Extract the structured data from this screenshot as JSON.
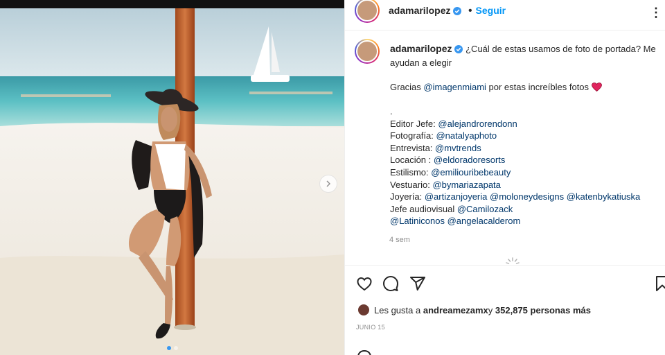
{
  "post": {
    "username": "adamarilopez",
    "follow_label": "Seguir",
    "more_label": "⋮"
  },
  "caption": {
    "username": "adamarilopez",
    "line1": "¿Cuál de estas usamos de foto de portada? Me",
    "line2": "ayudan a elegir",
    "thanks_prefix": "Gracias ",
    "thanks_mention": "@imagenmiami",
    "thanks_suffix": " por estas increíbles fotos ",
    "dot": ".",
    "credits": [
      {
        "label": "Editor Jefe: ",
        "mentions": [
          "@alejandrorendonn"
        ]
      },
      {
        "label": "Fotografía: ",
        "mentions": [
          "@natalyaphoto"
        ]
      },
      {
        "label": "Entrevista: ",
        "mentions": [
          "@mvtrends"
        ]
      },
      {
        "label": "Locación : ",
        "mentions": [
          "@eldoradoresorts"
        ]
      },
      {
        "label": "Estilismo: ",
        "mentions": [
          "@emiliouribebeauty"
        ]
      },
      {
        "label": "Vestuario: ",
        "mentions": [
          "@bymariazapata"
        ]
      },
      {
        "label": "Joyería: ",
        "mentions": [
          "@artizanjoyeria",
          "@moloneydesigns",
          "@katenbykatiuska"
        ]
      },
      {
        "label": "Jefe audiovisual ",
        "mentions": [
          "@Camilozack"
        ]
      },
      {
        "label": "",
        "mentions": [
          "@Latiniconos",
          "@angelacalderom"
        ]
      }
    ],
    "time_ago": "4 sem"
  },
  "likes": {
    "prefix": "Les gusta a ",
    "user": "andreamezamx",
    "middle": " y ",
    "count": "352,875 personas más"
  },
  "date": "JUNIO 15",
  "icons": {
    "heart": "heart-icon",
    "comment": "comment-icon",
    "share": "share-icon",
    "save": "bookmark-icon",
    "next": "chevron-right-icon",
    "verified": "verified-badge-icon",
    "heart_emoji": "red-heart-emoji"
  },
  "colors": {
    "link": "#00376b",
    "follow": "#0095f6",
    "verified": "#3897f0",
    "muted": "#8e8e8e"
  }
}
